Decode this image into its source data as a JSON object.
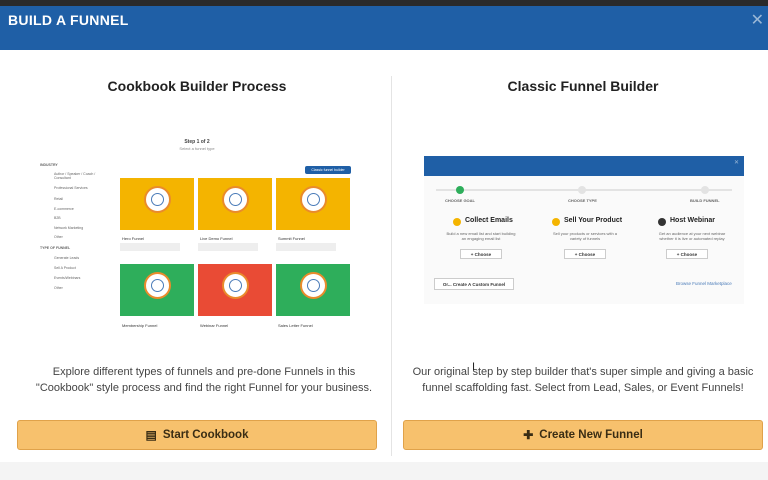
{
  "modal": {
    "title": "BUILD A FUNNEL",
    "close_icon": "close-icon"
  },
  "left": {
    "title": "Cookbook Builder Process",
    "description": "Explore different types of funnels and pre-done Funnels in this \"Cookbook\" style process and find the right Funnel for your business.",
    "button_label": "Start Cookbook",
    "button_icon": "book-icon",
    "preview": {
      "step": "Step 1 of 2",
      "step_sub": "Select a funnel type",
      "sidebar_groups": [
        {
          "heading": "INDUSTRY",
          "items": [
            "Author / Speaker / Coach / Consultant",
            "Professional Services",
            "Retail",
            "E-commerce",
            "B2B",
            "Network Marketing",
            "Other"
          ]
        },
        {
          "heading": "TYPE OF FUNNEL",
          "items": [
            "Generate Leads",
            "Sell A Product",
            "Events/Webinars",
            "Other"
          ]
        }
      ],
      "blue_button": "Classic funnel builder",
      "cards": [
        {
          "label": "Hero Funnel",
          "color": "#f4b400"
        },
        {
          "label": "Live Demo Funnel",
          "color": "#f4b400"
        },
        {
          "label": "Summit Funnel",
          "color": "#f4b400"
        },
        {
          "label": "Membership Funnel",
          "color": "#2eae5b"
        },
        {
          "label": "Webinar Funnel",
          "color": "#e94b35"
        },
        {
          "label": "Sales Letter Funnel",
          "color": "#2eae5b"
        }
      ]
    }
  },
  "right": {
    "title": "Classic Funnel Builder",
    "description": "Our original step by step builder that's super simple and giving a basic funnel scaffolding fast. Select from Lead, Sales, or Event Funnels!",
    "button_label": "Create New Funnel",
    "button_icon": "plus-icon",
    "preview": {
      "steps": [
        "CHOOSE GOAL",
        "CHOOSE TYPE",
        "BUILD FUNNEL"
      ],
      "options": [
        {
          "title": "Collect Emails",
          "text": "Build a new email list and start building an engaging email list",
          "icon_color": "#f4b400"
        },
        {
          "title": "Sell Your Product",
          "text": "Sell your products or services with a variety of funnels",
          "icon_color": "#f4b400"
        },
        {
          "title": "Host Webinar",
          "text": "Get an audience at your next webinar whether it is live or automated replay",
          "icon_color": "#333333"
        }
      ],
      "choose_label": "+ Choose",
      "custom_label": "Or... Create A Custom Funnel",
      "marketplace_label": "Browse Funnel Marketplace"
    }
  },
  "colors": {
    "header": "#1f5fa6",
    "button": "#f7c16d"
  }
}
